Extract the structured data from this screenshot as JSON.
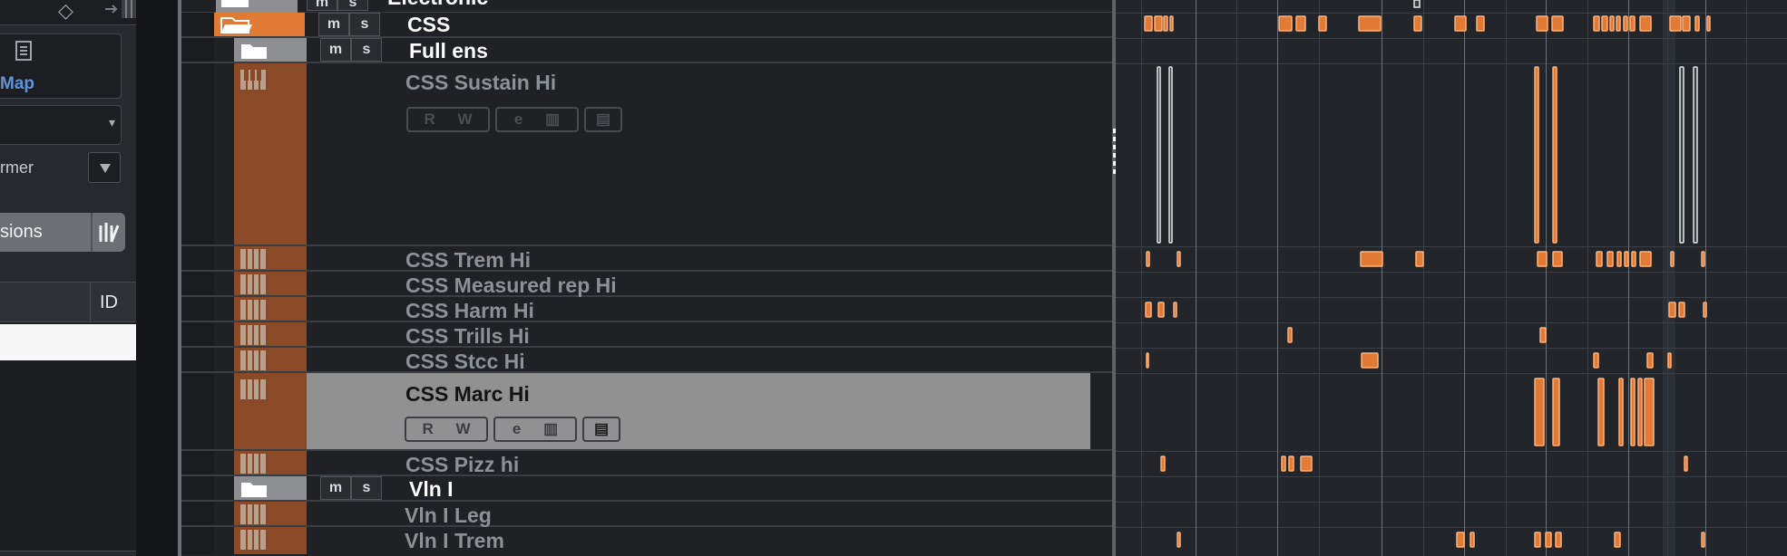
{
  "inspector": {
    "map_label": "Map",
    "transformer_label": "rmer",
    "dropdown_arrow": "▾",
    "expressions_label": "sions",
    "table_id_header": "ID",
    "colors": {
      "accent": "#5f95d8"
    }
  },
  "tracks": [
    {
      "name": "Electronic",
      "type": "folder"
    },
    {
      "name": "CSS",
      "type": "folder"
    },
    {
      "name": "Full ens",
      "type": "folder"
    },
    {
      "name": "CSS Sustain Hi",
      "type": "instrument"
    },
    {
      "name": "CSS Trem Hi",
      "type": "instrument"
    },
    {
      "name": "CSS Measured rep Hi",
      "type": "instrument"
    },
    {
      "name": "CSS Harm Hi",
      "type": "instrument"
    },
    {
      "name": "CSS Trills Hi",
      "type": "instrument"
    },
    {
      "name": "CSS Stcc Hi",
      "type": "instrument"
    },
    {
      "name": "CSS Marc  Hi",
      "type": "instrument",
      "selected": true
    },
    {
      "name": "CSS Pizz hi",
      "type": "instrument"
    },
    {
      "name": "Vln I",
      "type": "folder"
    },
    {
      "name": "Vln I Leg",
      "type": "instrument"
    },
    {
      "name": "Vln I Trem",
      "type": "instrument"
    }
  ],
  "controls": {
    "mute_label": "m",
    "solo_label": "s",
    "read_label": "R",
    "write_label": "W",
    "edit_label": "e"
  },
  "colors": {
    "track_orange": "#e07a35",
    "track_strip": "#8a4a27",
    "selected_track": "#919191"
  }
}
